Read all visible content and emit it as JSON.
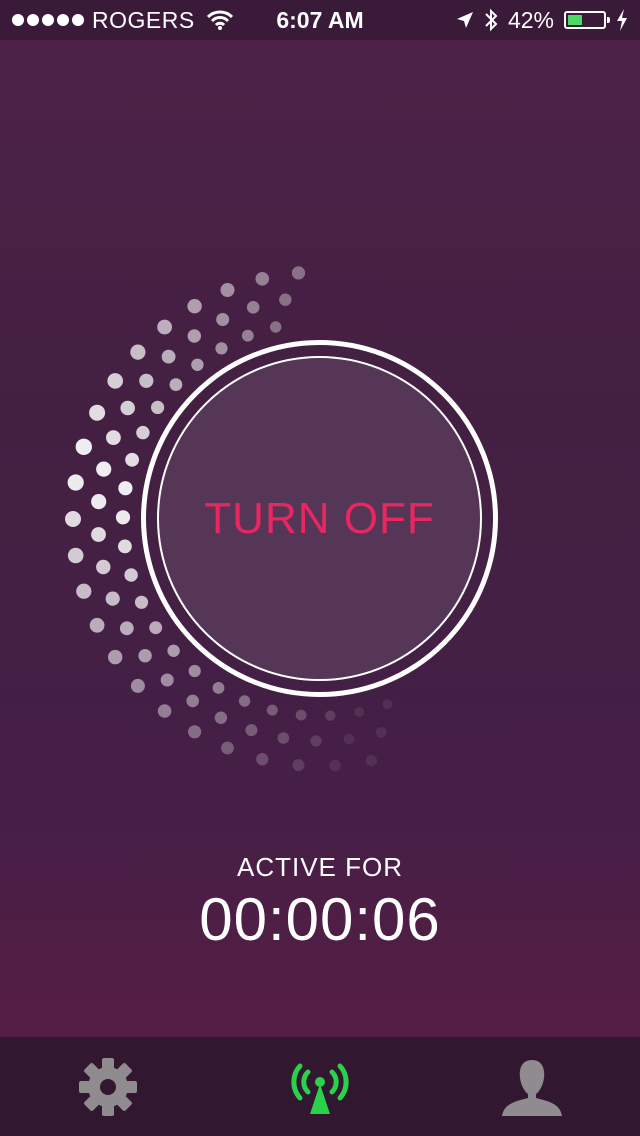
{
  "status_bar": {
    "carrier": "ROGERS",
    "time": "6:07 AM",
    "battery_percent": "42%",
    "battery_level": 0.42,
    "battery_color": "#4cd964"
  },
  "main": {
    "button_label": "TURN OFF",
    "button_label_color": "#e8265f",
    "active_label": "ACTIVE FOR",
    "timer": "00:00:06"
  },
  "tab_bar": {
    "tabs": [
      {
        "name": "settings",
        "icon": "gear-icon",
        "active": false
      },
      {
        "name": "broadcast",
        "icon": "broadcast-tower-icon",
        "active": true,
        "color": "#2ad14b"
      },
      {
        "name": "profile",
        "icon": "person-icon",
        "active": false
      }
    ]
  }
}
